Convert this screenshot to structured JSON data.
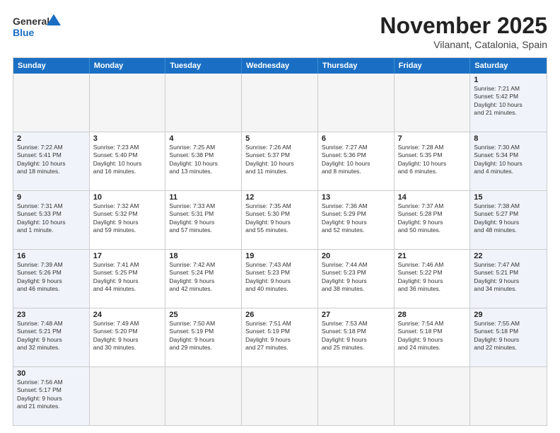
{
  "header": {
    "logo_general": "General",
    "logo_blue": "Blue",
    "month": "November 2025",
    "location": "Vilanant, Catalonia, Spain"
  },
  "days_of_week": [
    "Sunday",
    "Monday",
    "Tuesday",
    "Wednesday",
    "Thursday",
    "Friday",
    "Saturday"
  ],
  "weeks": [
    [
      {
        "day": "",
        "info": "",
        "empty": true
      },
      {
        "day": "",
        "info": "",
        "empty": true
      },
      {
        "day": "",
        "info": "",
        "empty": true
      },
      {
        "day": "",
        "info": "",
        "empty": true
      },
      {
        "day": "",
        "info": "",
        "empty": true
      },
      {
        "day": "",
        "info": "",
        "empty": true
      },
      {
        "day": "1",
        "info": "Sunrise: 7:21 AM\nSunset: 5:42 PM\nDaylight: 10 hours\nand 21 minutes.",
        "empty": false,
        "weekend": true
      }
    ],
    [
      {
        "day": "2",
        "info": "Sunrise: 7:22 AM\nSunset: 5:41 PM\nDaylight: 10 hours\nand 18 minutes.",
        "weekend": true
      },
      {
        "day": "3",
        "info": "Sunrise: 7:23 AM\nSunset: 5:40 PM\nDaylight: 10 hours\nand 16 minutes."
      },
      {
        "day": "4",
        "info": "Sunrise: 7:25 AM\nSunset: 5:38 PM\nDaylight: 10 hours\nand 13 minutes."
      },
      {
        "day": "5",
        "info": "Sunrise: 7:26 AM\nSunset: 5:37 PM\nDaylight: 10 hours\nand 11 minutes."
      },
      {
        "day": "6",
        "info": "Sunrise: 7:27 AM\nSunset: 5:36 PM\nDaylight: 10 hours\nand 8 minutes."
      },
      {
        "day": "7",
        "info": "Sunrise: 7:28 AM\nSunset: 5:35 PM\nDaylight: 10 hours\nand 6 minutes."
      },
      {
        "day": "8",
        "info": "Sunrise: 7:30 AM\nSunset: 5:34 PM\nDaylight: 10 hours\nand 4 minutes.",
        "weekend": true
      }
    ],
    [
      {
        "day": "9",
        "info": "Sunrise: 7:31 AM\nSunset: 5:33 PM\nDaylight: 10 hours\nand 1 minute.",
        "weekend": true
      },
      {
        "day": "10",
        "info": "Sunrise: 7:32 AM\nSunset: 5:32 PM\nDaylight: 9 hours\nand 59 minutes."
      },
      {
        "day": "11",
        "info": "Sunrise: 7:33 AM\nSunset: 5:31 PM\nDaylight: 9 hours\nand 57 minutes."
      },
      {
        "day": "12",
        "info": "Sunrise: 7:35 AM\nSunset: 5:30 PM\nDaylight: 9 hours\nand 55 minutes."
      },
      {
        "day": "13",
        "info": "Sunrise: 7:36 AM\nSunset: 5:29 PM\nDaylight: 9 hours\nand 52 minutes."
      },
      {
        "day": "14",
        "info": "Sunrise: 7:37 AM\nSunset: 5:28 PM\nDaylight: 9 hours\nand 50 minutes."
      },
      {
        "day": "15",
        "info": "Sunrise: 7:38 AM\nSunset: 5:27 PM\nDaylight: 9 hours\nand 48 minutes.",
        "weekend": true
      }
    ],
    [
      {
        "day": "16",
        "info": "Sunrise: 7:39 AM\nSunset: 5:26 PM\nDaylight: 9 hours\nand 46 minutes.",
        "weekend": true
      },
      {
        "day": "17",
        "info": "Sunrise: 7:41 AM\nSunset: 5:25 PM\nDaylight: 9 hours\nand 44 minutes."
      },
      {
        "day": "18",
        "info": "Sunrise: 7:42 AM\nSunset: 5:24 PM\nDaylight: 9 hours\nand 42 minutes."
      },
      {
        "day": "19",
        "info": "Sunrise: 7:43 AM\nSunset: 5:23 PM\nDaylight: 9 hours\nand 40 minutes."
      },
      {
        "day": "20",
        "info": "Sunrise: 7:44 AM\nSunset: 5:23 PM\nDaylight: 9 hours\nand 38 minutes."
      },
      {
        "day": "21",
        "info": "Sunrise: 7:46 AM\nSunset: 5:22 PM\nDaylight: 9 hours\nand 36 minutes."
      },
      {
        "day": "22",
        "info": "Sunrise: 7:47 AM\nSunset: 5:21 PM\nDaylight: 9 hours\nand 34 minutes.",
        "weekend": true
      }
    ],
    [
      {
        "day": "23",
        "info": "Sunrise: 7:48 AM\nSunset: 5:21 PM\nDaylight: 9 hours\nand 32 minutes.",
        "weekend": true
      },
      {
        "day": "24",
        "info": "Sunrise: 7:49 AM\nSunset: 5:20 PM\nDaylight: 9 hours\nand 30 minutes."
      },
      {
        "day": "25",
        "info": "Sunrise: 7:50 AM\nSunset: 5:19 PM\nDaylight: 9 hours\nand 29 minutes."
      },
      {
        "day": "26",
        "info": "Sunrise: 7:51 AM\nSunset: 5:19 PM\nDaylight: 9 hours\nand 27 minutes."
      },
      {
        "day": "27",
        "info": "Sunrise: 7:53 AM\nSunset: 5:18 PM\nDaylight: 9 hours\nand 25 minutes."
      },
      {
        "day": "28",
        "info": "Sunrise: 7:54 AM\nSunset: 5:18 PM\nDaylight: 9 hours\nand 24 minutes."
      },
      {
        "day": "29",
        "info": "Sunrise: 7:55 AM\nSunset: 5:18 PM\nDaylight: 9 hours\nand 22 minutes.",
        "weekend": true
      }
    ],
    [
      {
        "day": "30",
        "info": "Sunrise: 7:56 AM\nSunset: 5:17 PM\nDaylight: 9 hours\nand 21 minutes.",
        "weekend": true
      },
      {
        "day": "",
        "info": "",
        "empty": true
      },
      {
        "day": "",
        "info": "",
        "empty": true
      },
      {
        "day": "",
        "info": "",
        "empty": true
      },
      {
        "day": "",
        "info": "",
        "empty": true
      },
      {
        "day": "",
        "info": "",
        "empty": true
      },
      {
        "day": "",
        "info": "",
        "empty": true
      }
    ]
  ]
}
